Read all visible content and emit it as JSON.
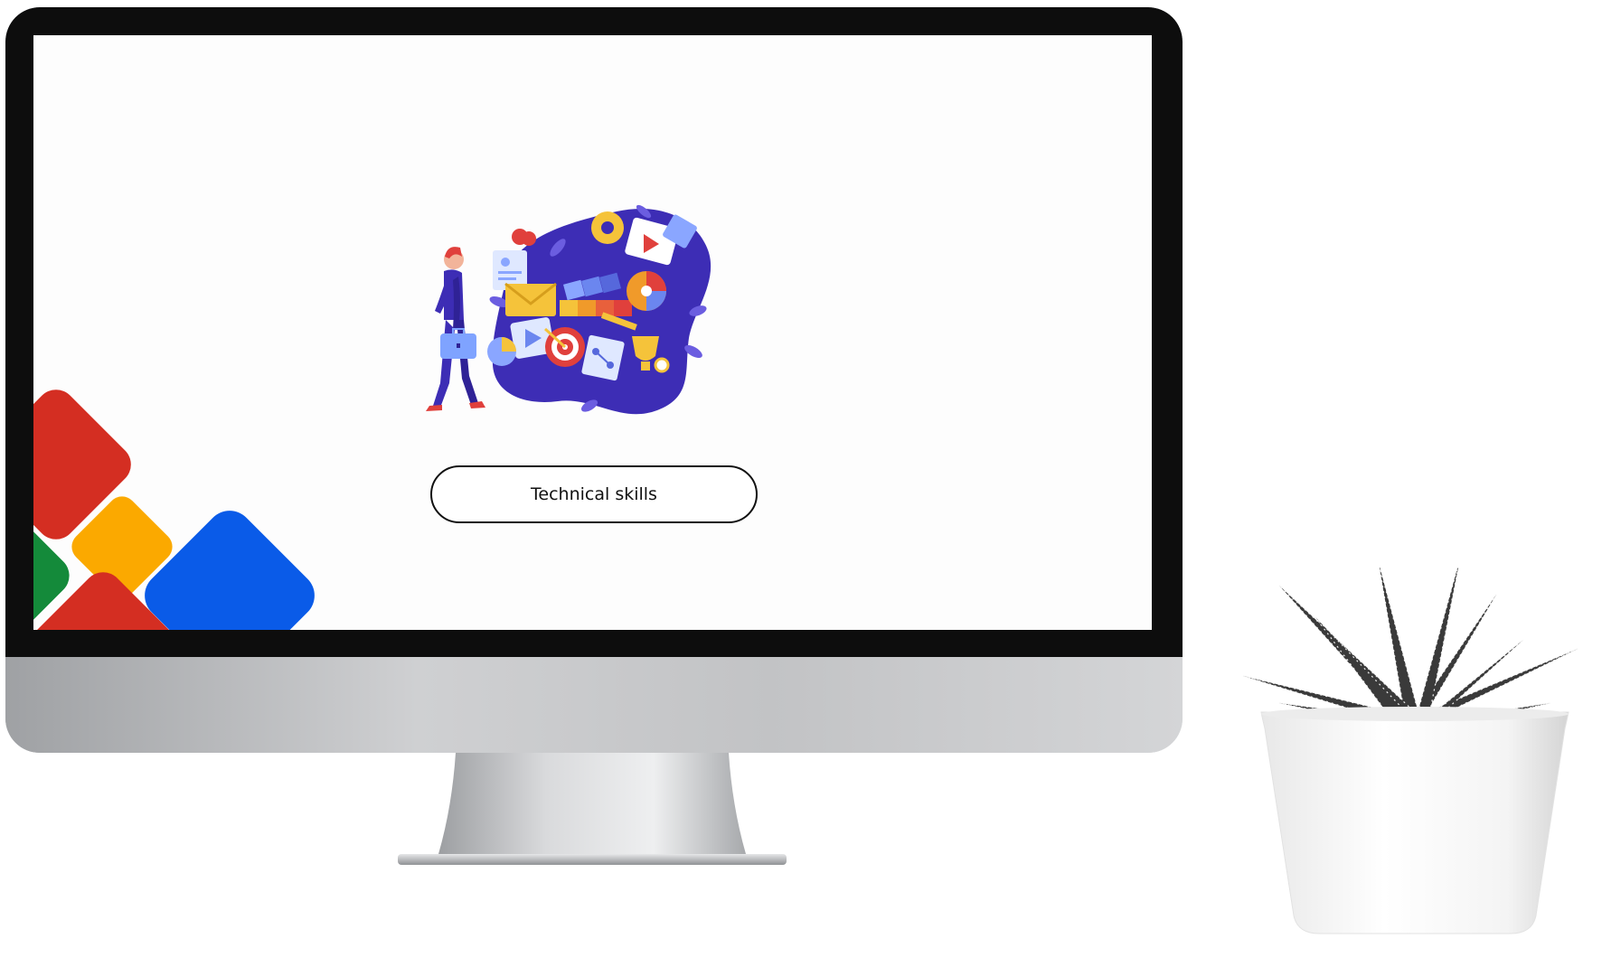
{
  "screen": {
    "button_label": "Technical skills"
  },
  "colors": {
    "tile_red": "#d42e22",
    "tile_yellow": "#fba900",
    "tile_green": "#148a3a",
    "tile_blue": "#0a5be8",
    "illustration_blob": "#3d2db5"
  },
  "icons": {
    "illustration": "walking-businessman-with-skills-collage-icon",
    "plant": "potted-succulent-plant-icon"
  }
}
